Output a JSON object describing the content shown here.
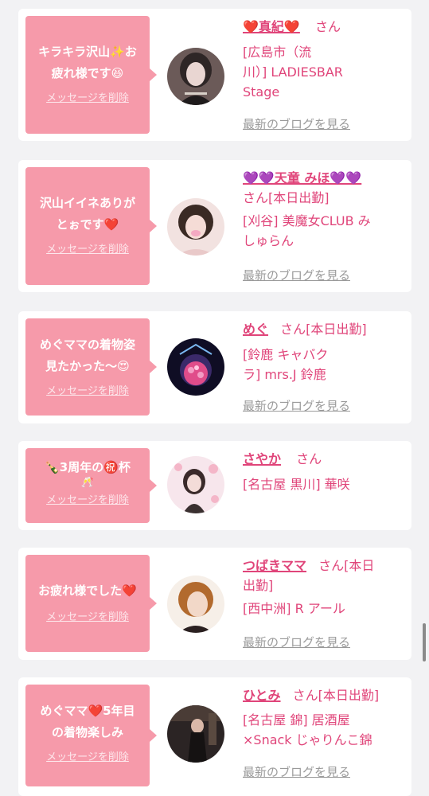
{
  "colors": {
    "accent": "#e0457a",
    "bubble": "#f69aaa",
    "link_gray": "#9a9a9a",
    "background": "#f2f2f4"
  },
  "delete_label": "メッセージを削除",
  "blog_label": "最新のブログを見る",
  "messages": [
    {
      "msg_l1": "キラキラ沢山✨お",
      "msg_l2": "疲れ様です😆",
      "name": "❤️真紀❤️",
      "honor": "さん",
      "shop_l1": "[広島市（流",
      "shop_l2": "川）] LADIESBAR",
      "shop_l3": "Stage",
      "avatar_icon": "woman-portrait-icon"
    },
    {
      "msg_l1": "沢山イイネありが",
      "msg_l2": "とぉです❤️",
      "name": "💜💜天童 みほ💜💜",
      "honor": "さん[本日出勤]",
      "shop_l1": "[刈谷] 美魔女CLUB み",
      "shop_l2": "しゅらん",
      "shop_l3": "",
      "avatar_icon": "woman-portrait-icon"
    },
    {
      "msg_l1": "めぐママの着物姿",
      "msg_l2": "見たかった〜😍",
      "name": "めぐ",
      "honor": "さん[本日出勤]",
      "shop_l1": "[鈴鹿 キャバク",
      "shop_l2": "ラ] mrs.J 鈴鹿",
      "shop_l3": "",
      "avatar_icon": "flower-globe-icon"
    },
    {
      "msg_l1": "🍾3周年の㊗️杯",
      "msg_l2": "🥂",
      "name": "さやか",
      "honor": "さん",
      "shop_l1": "[名古屋 黒川] 華咲",
      "shop_l2": "",
      "shop_l3": "",
      "avatar_icon": "woman-portrait-icon"
    },
    {
      "msg_l1": "お疲れ様でした❤️",
      "msg_l2": "",
      "name": "つばきママ",
      "honor": "さん[本日",
      "honor2": "出勤]",
      "shop_l1": "[西中洲] R アール",
      "shop_l2": "",
      "shop_l3": "",
      "avatar_icon": "woman-portrait-icon"
    },
    {
      "msg_l1": "めぐママ❤️5年目",
      "msg_l2": "の着物楽しみ",
      "name": "ひとみ",
      "honor": "さん[本日出勤]",
      "shop_l1": "[名古屋 錦] 居酒屋",
      "shop_l2": "×Snack じゃりんこ錦",
      "shop_l3": "",
      "avatar_icon": "woman-portrait-icon"
    }
  ]
}
